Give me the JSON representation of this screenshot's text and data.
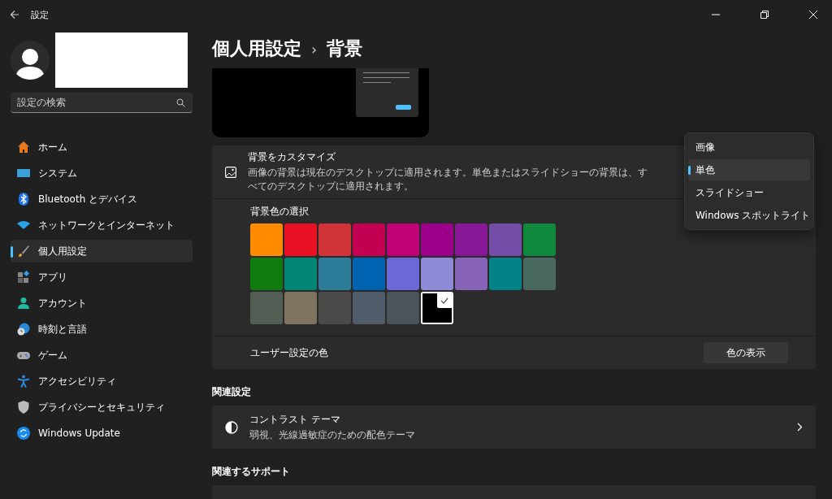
{
  "window": {
    "title": "設定"
  },
  "sidebar": {
    "search": {
      "placeholder": "設定の検索"
    },
    "items": [
      {
        "label": "ホーム",
        "kind": "home",
        "selected": false
      },
      {
        "label": "システム",
        "kind": "system",
        "selected": false
      },
      {
        "label": "Bluetooth とデバイス",
        "kind": "bluetooth",
        "selected": false
      },
      {
        "label": "ネットワークとインターネット",
        "kind": "network",
        "selected": false
      },
      {
        "label": "個人用設定",
        "kind": "personalize",
        "selected": true
      },
      {
        "label": "アプリ",
        "kind": "apps",
        "selected": false
      },
      {
        "label": "アカウント",
        "kind": "account",
        "selected": false
      },
      {
        "label": "時刻と言語",
        "kind": "time",
        "selected": false
      },
      {
        "label": "ゲーム",
        "kind": "game",
        "selected": false
      },
      {
        "label": "アクセシビリティ",
        "kind": "accessibility",
        "selected": false
      },
      {
        "label": "プライバシーとセキュリティ",
        "kind": "privacy",
        "selected": false
      },
      {
        "label": "Windows Update",
        "kind": "update",
        "selected": false
      }
    ]
  },
  "breadcrumb": {
    "parent": "個人用設定",
    "separator": "›",
    "current": "背景"
  },
  "customize": {
    "title": "背景をカスタマイズ",
    "description": "画像の背景は現在のデスクトップに適用されます。単色またはスライドショーの背景は、すべてのデスクトップに適用されます。",
    "dropdown_options": [
      {
        "label": "画像",
        "selected": false
      },
      {
        "label": "単色",
        "selected": true
      },
      {
        "label": "スライドショー",
        "selected": false
      },
      {
        "label": "Windows スポットライト",
        "selected": false
      }
    ],
    "color_picker_title": "背景色の選択",
    "swatches": [
      {
        "color": "#ff8c00",
        "selected": false
      },
      {
        "color": "#e81123",
        "selected": false
      },
      {
        "color": "#d13438",
        "selected": false
      },
      {
        "color": "#c30052",
        "selected": false
      },
      {
        "color": "#bf0077",
        "selected": false
      },
      {
        "color": "#9a0089",
        "selected": false
      },
      {
        "color": "#881798",
        "selected": false
      },
      {
        "color": "#744da9",
        "selected": false
      },
      {
        "color": "#10893e",
        "selected": false
      },
      {
        "color": "#107c10",
        "selected": false
      },
      {
        "color": "#018574",
        "selected": false
      },
      {
        "color": "#2d7d9a",
        "selected": false
      },
      {
        "color": "#0063b1",
        "selected": false
      },
      {
        "color": "#6b69d6",
        "selected": false
      },
      {
        "color": "#8e8cd8",
        "selected": false
      },
      {
        "color": "#8764b8",
        "selected": false
      },
      {
        "color": "#038387",
        "selected": false
      },
      {
        "color": "#486860",
        "selected": false
      },
      {
        "color": "#525e54",
        "selected": false
      },
      {
        "color": "#7e735f",
        "selected": false
      },
      {
        "color": "#4c4a48",
        "selected": false
      },
      {
        "color": "#515c6b",
        "selected": false
      },
      {
        "color": "#4a5459",
        "selected": false
      },
      {
        "color": "#000000",
        "selected": true
      }
    ],
    "custom_color_label": "ユーザー設定の色",
    "custom_color_button": "色の表示"
  },
  "related_settings": {
    "heading": "関連設定",
    "items": [
      {
        "title": "コントラスト テーマ",
        "description": "弱視、光線過敏症のための配色テーマ"
      }
    ]
  },
  "related_support": {
    "heading": "関連するサポート"
  }
}
